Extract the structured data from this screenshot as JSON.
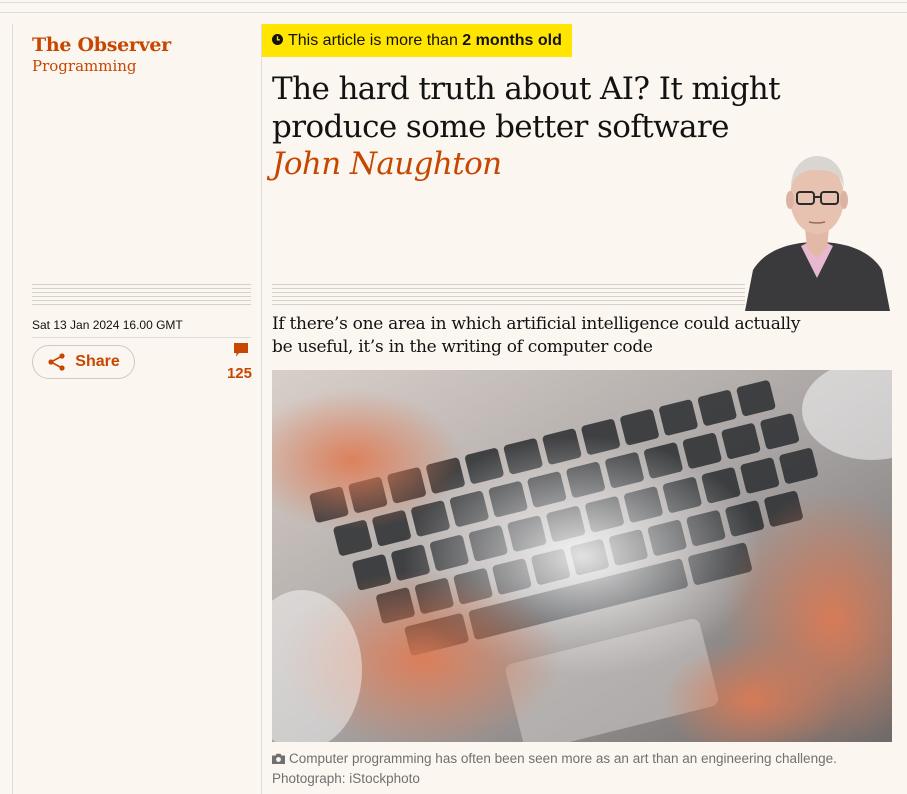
{
  "section": {
    "title": "The Observer",
    "subtitle": "Programming"
  },
  "age_notice": {
    "prefix": "This article is more than ",
    "emphasis": "2 months old",
    "icon": "clock-icon"
  },
  "article": {
    "headline": "The hard truth about AI? It might produce some better software",
    "byline": "John Naughton",
    "standfirst": "If there’s one area in which artificial intelligence could actually be useful, it’s in the writing of computer code",
    "date": "Sat 13 Jan 2024 16.00 GMT"
  },
  "share": {
    "label": "Share",
    "icon": "share-icon"
  },
  "comments": {
    "count": "125",
    "icon": "comment-icon"
  },
  "image": {
    "caption": "Computer programming has often been seen more as an art than an engineering challenge. Photograph: iStockphoto",
    "icon": "camera-icon"
  },
  "colors": {
    "accent": "#c74600",
    "badge": "#ffe500",
    "background": "#fbf6ef"
  }
}
